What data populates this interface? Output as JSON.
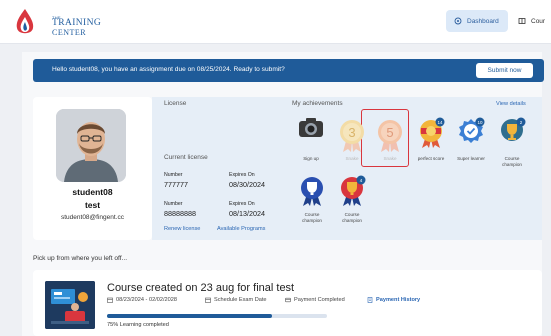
{
  "header": {
    "logo_small": "THE",
    "logo_main": "TRAINING",
    "logo_sub": "CENTER",
    "nav_dashboard": "Dashboard",
    "nav_course": "Cour"
  },
  "banner": {
    "message": "Hello student08, you have an assignment due on 08/25/2024. Ready to submit?",
    "button": "Submit now"
  },
  "profile": {
    "first_line": "student08",
    "second_line": "test",
    "email": "student08@fingent.cc"
  },
  "license": {
    "title": "License",
    "current_title": "Current license",
    "rows": [
      {
        "number_label": "Number",
        "number": "777777",
        "expires_label": "Expires On",
        "expires": "08/30/2024"
      },
      {
        "number_label": "Number",
        "number": "88888888",
        "expires_label": "Expires On",
        "expires": "08/13/2024"
      }
    ],
    "renew_link": "Renew license",
    "available_link": "Available Programs"
  },
  "achievements": {
    "title": "My achievements",
    "view_details": "View details",
    "items": [
      {
        "label": "Sign up",
        "icon": "camera-badge-icon"
      },
      {
        "label": "Snake",
        "icon": "medal-3-icon",
        "badge_text": "3"
      },
      {
        "label": "Snake",
        "icon": "medal-5-icon",
        "badge_text": "5"
      },
      {
        "label": "perfect score",
        "icon": "perfect-score-badge-icon",
        "count": "14"
      },
      {
        "label": "Super learner",
        "icon": "super-learner-badge-icon",
        "count": "10"
      },
      {
        "label": "Course champion",
        "icon": "trophy-badge-icon",
        "count": "2"
      },
      {
        "label": "Course champion",
        "icon": "trophy-badge-icon"
      },
      {
        "label": "Course champion",
        "icon": "trophy-badge-icon",
        "count": "4"
      }
    ]
  },
  "pickup": {
    "heading": "Pick up from where you left off...",
    "course": {
      "title": "Course created on 23 aug for final test",
      "dates": "08/23/2024 - 02/02/2028",
      "schedule": "Schedule Exam Date",
      "payment": "Payment Completed",
      "history": "Payment History",
      "progress_percent": 75,
      "progress_text": "75% Learning completed"
    }
  },
  "colors": {
    "primary": "#1f5b99",
    "highlight": "#d9363e"
  }
}
